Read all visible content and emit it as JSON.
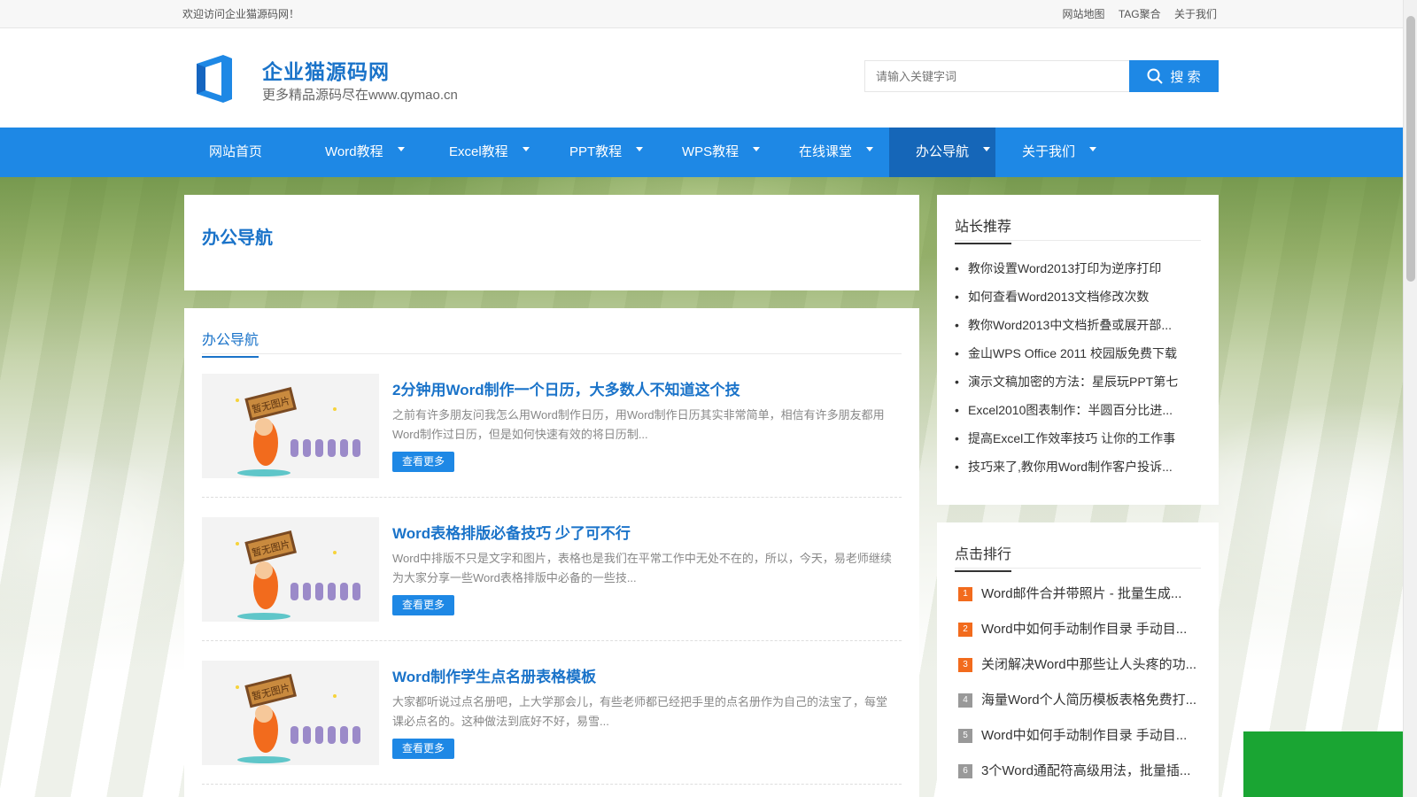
{
  "topbar": {
    "welcome": "欢迎访问企业猫源码网！",
    "links": [
      "网站地图",
      "TAG聚合",
      "关于我们"
    ]
  },
  "header": {
    "site_name": "企业猫源码网",
    "site_sub": "更多精品源码尽在www.qymao.cn",
    "search_placeholder": "请输入关键字词",
    "search_label": "搜 索"
  },
  "nav": {
    "items": [
      {
        "label": "网站首页",
        "has_dropdown": false
      },
      {
        "label": "Word教程",
        "has_dropdown": true
      },
      {
        "label": "Excel教程",
        "has_dropdown": true
      },
      {
        "label": "PPT教程",
        "has_dropdown": true
      },
      {
        "label": "WPS教程",
        "has_dropdown": true
      },
      {
        "label": "在线课堂",
        "has_dropdown": true
      },
      {
        "label": "办公导航",
        "has_dropdown": true,
        "active": true
      },
      {
        "label": "关于我们",
        "has_dropdown": true
      }
    ]
  },
  "main": {
    "page_title": "办公导航",
    "list_title": "办公导航",
    "thumb_text": "暂无图片",
    "more_label": "查看更多",
    "articles": [
      {
        "title": "2分钟用Word制作一个日历，大多数人不知道这个技",
        "desc": "之前有许多朋友问我怎么用Word制作日历，用Word制作日历其实非常简单，相信有许多朋友都用Word制作过日历，但是如何快速有效的将日历制..."
      },
      {
        "title": "Word表格排版必备技巧 少了可不行",
        "desc": "Word中排版不只是文字和图片，表格也是我们在平常工作中无处不在的，所以，今天，易老师继续为大家分享一些Word表格排版中必备的一些技..."
      },
      {
        "title": "Word制作学生点名册表格模板",
        "desc": "大家都听说过点名册吧，上大学那会儿，有些老师都已经把手里的点名册作为自己的法宝了，每堂课必点名的。这种做法到底好不好，易雪..."
      }
    ]
  },
  "sidebar": {
    "recommend_title": "站长推荐",
    "recommend": [
      "教你设置Word2013打印为逆序打印",
      "如何查看Word2013文档修改次数",
      "教你Word2013中文档折叠或展开部...",
      "金山WPS Office 2011 校园版免费下载",
      "演示文稿加密的方法：星辰玩PPT第七",
      "Excel2010图表制作：半圆百分比进...",
      "提高Excel工作效率技巧 让你的工作事",
      "技巧来了,教你用Word制作客户投诉..."
    ],
    "ranking_title": "点击排行",
    "ranking": [
      {
        "num": "1",
        "title": "Word邮件合并带照片 - 批量生成...",
        "color": "#f26b1d"
      },
      {
        "num": "2",
        "title": "Word中如何手动制作目录 手动目...",
        "color": "#f26b1d"
      },
      {
        "num": "3",
        "title": "关闭解决Word中那些让人头疼的功...",
        "color": "#f26b1d"
      },
      {
        "num": "4",
        "title": "海量Word个人简历模板表格免费打...",
        "color": "#999999"
      },
      {
        "num": "5",
        "title": "Word中如何手动制作目录 手动目...",
        "color": "#999999"
      },
      {
        "num": "6",
        "title": "3个Word通配符高级用法，批量插...",
        "color": "#999999"
      }
    ]
  },
  "colors": {
    "brand_blue": "#1e88e5",
    "title_blue": "#1a73c9",
    "nav_active": "#1566b8",
    "rank_hot": "#f26b1d",
    "rank_normal": "#999999"
  }
}
